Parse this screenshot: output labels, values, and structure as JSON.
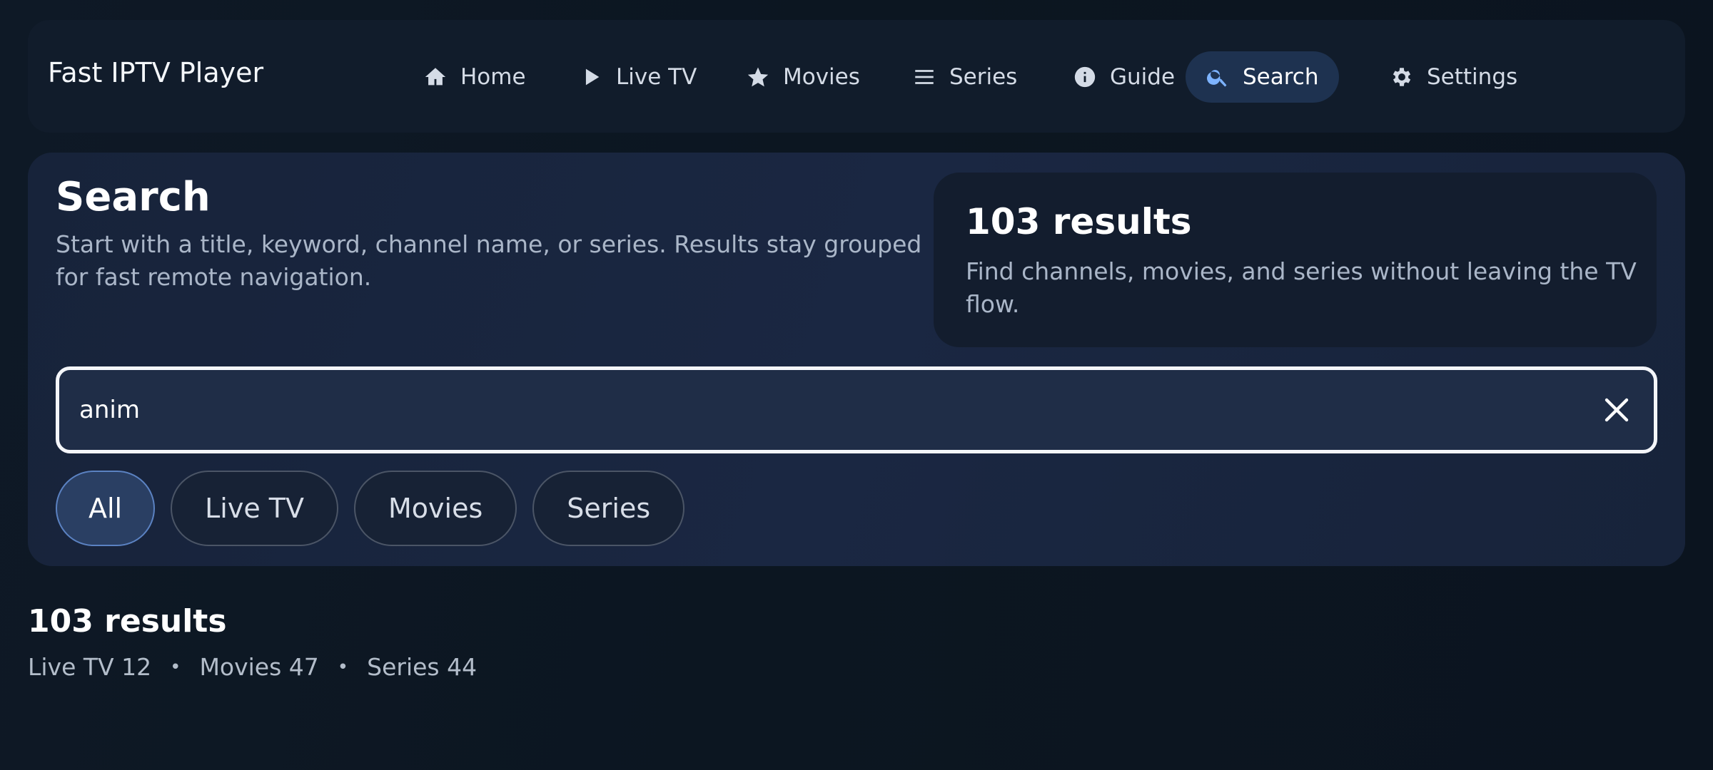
{
  "app": {
    "title": "Fast IPTV Player"
  },
  "nav": {
    "items": [
      {
        "label": "Home",
        "icon": "home-icon"
      },
      {
        "label": "Live TV",
        "icon": "play-icon"
      },
      {
        "label": "Movies",
        "icon": "star-icon"
      },
      {
        "label": "Series",
        "icon": "menu-icon"
      },
      {
        "label": "Guide",
        "icon": "info-icon"
      },
      {
        "label": "Search",
        "icon": "search-icon",
        "active": true
      },
      {
        "label": "Settings",
        "icon": "gear-icon"
      }
    ]
  },
  "hero": {
    "title": "Search",
    "description": "Start with a title, keyword, channel name, or series. Results stay grouped for fast remote navigation.",
    "summary": {
      "count": "103 results",
      "description": "Find channels, movies, and series without leaving the TV flow."
    }
  },
  "search": {
    "value": "anim",
    "clear_icon": "close-icon"
  },
  "filters": {
    "items": [
      {
        "label": "All",
        "active": true
      },
      {
        "label": "Live TV"
      },
      {
        "label": "Movies"
      },
      {
        "label": "Series"
      }
    ]
  },
  "results": {
    "count": "103 results",
    "breakdown": [
      "Live TV 12",
      "Movies 47",
      "Series 44"
    ],
    "separator": "•"
  },
  "colors": {
    "background": "#0b1520",
    "accent": "#7db3ff",
    "active_nav_bg": "#1e3250",
    "active_chip_bg": "#2a3f63"
  }
}
